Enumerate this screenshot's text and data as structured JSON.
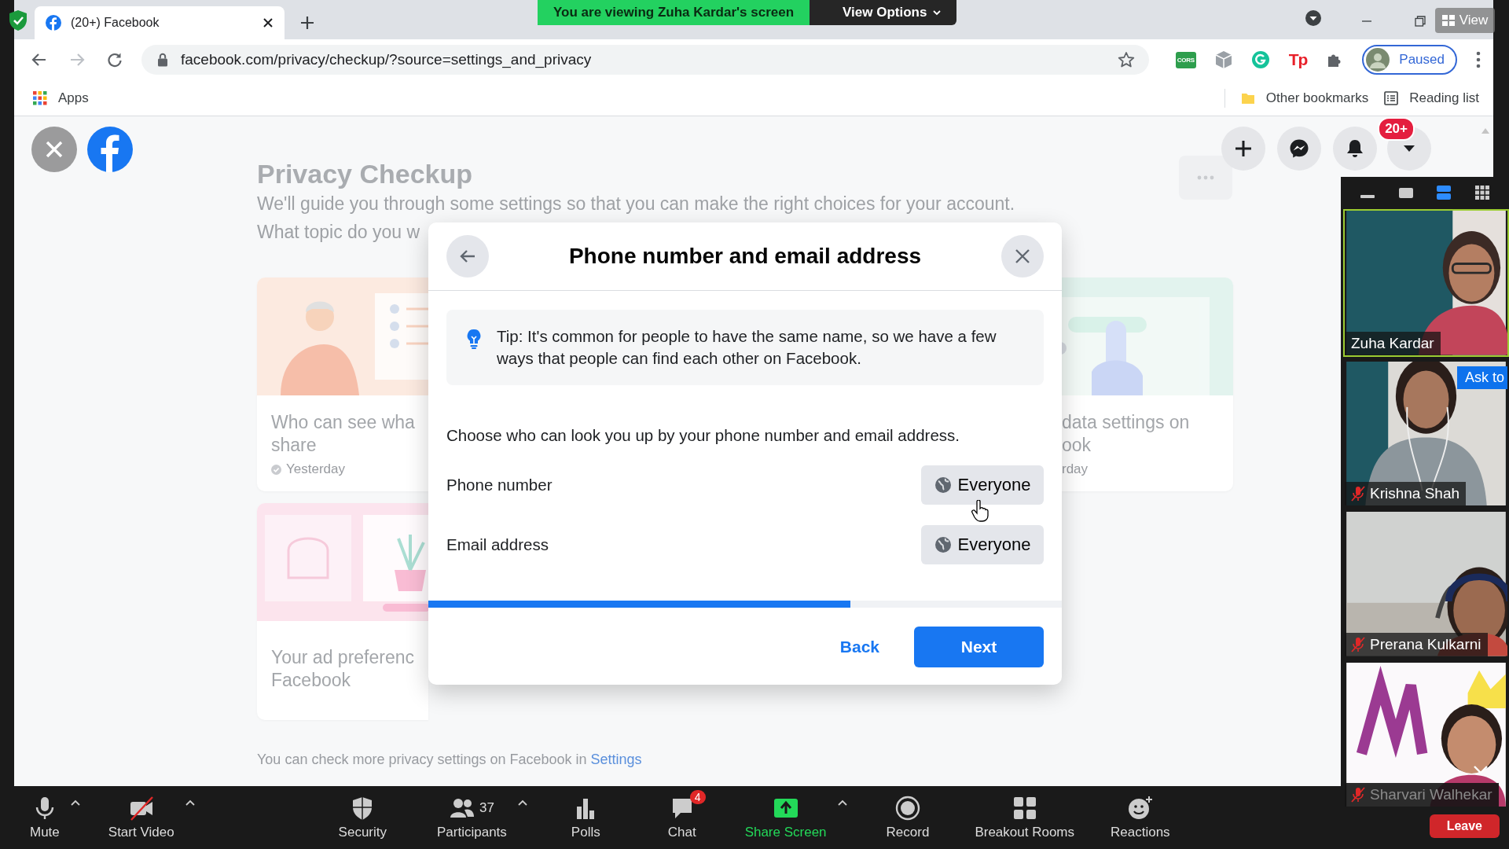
{
  "zoom_banner": {
    "message": "You are viewing Zuha Kardar's screen",
    "options_button": "View Options"
  },
  "view_button": "View",
  "browser": {
    "tab": {
      "title": "(20+) Facebook"
    },
    "url": "facebook.com/privacy/checkup/?source=settings_and_privacy",
    "extensions": [
      {
        "kind": "cors",
        "label": "CORS"
      },
      {
        "kind": "cube"
      },
      {
        "kind": "grammar"
      },
      {
        "kind": "tp",
        "label": "Tp"
      },
      {
        "kind": "puzzle"
      }
    ],
    "profile": "Paused",
    "bookmarks": {
      "apps": "Apps",
      "other": "Other bookmarks",
      "reading_list": "Reading list"
    }
  },
  "page": {
    "notification_badge": "20+",
    "title": "Privacy Checkup",
    "subtitle": [
      "We'll guide you through some settings so that you can make the right choices for your account.",
      "What topic do you w"
    ],
    "cards": [
      {
        "kind": "audience",
        "color": "#fbe3d6",
        "title_lines": [
          "Who can see wha",
          "share"
        ],
        "meta": "Yesterday",
        "done": true
      },
      {
        "kind": "data",
        "color": "#d9efe9",
        "title_lines": [
          "data settings on",
          "ook"
        ],
        "meta": "rday",
        "done": false
      },
      {
        "kind": "ads",
        "color": "#fbdbe8",
        "title_lines": [
          "Your ad preferenc",
          "Facebook"
        ]
      }
    ],
    "footer": {
      "text": "You can check more privacy settings on Facebook in ",
      "link": "Settings"
    }
  },
  "modal": {
    "title": "Phone number and email address",
    "tip": "Tip: It's common for people to have the same name, so we have a few ways that people can find each other on Facebook.",
    "prompt": "Choose who can look you up by your phone number and email address.",
    "settings": [
      {
        "label": "Phone number",
        "value": "Everyone"
      },
      {
        "label": "Email address",
        "value": "Everyone"
      }
    ],
    "progress": {
      "level": 0.666
    },
    "back": "Back",
    "next": "Next"
  },
  "video_panel": {
    "views": [
      {
        "kind": "minimize",
        "selected": false
      },
      {
        "kind": "single",
        "selected": false
      },
      {
        "kind": "strip",
        "selected": true
      },
      {
        "kind": "gallery",
        "selected": false
      }
    ],
    "tiles": [
      {
        "kind": "office",
        "name": "Zuha Kardar",
        "muted": false,
        "speaking": true,
        "faded": false
      },
      {
        "kind": "office2",
        "name": "Krishna Shah",
        "muted": true,
        "speaking": false,
        "faded": false,
        "action": "Ask to"
      },
      {
        "kind": "room",
        "name": "Prerana Kulkarni",
        "muted": true,
        "speaking": false,
        "faded": false
      },
      {
        "kind": "banner",
        "name": "Sharvari Walhekar",
        "muted": true,
        "speaking": false,
        "faded": true
      }
    ]
  },
  "toolbar": {
    "items": [
      {
        "kind": "mic",
        "label": "Mute",
        "caret": true,
        "highlight": false
      },
      {
        "kind": "video-off",
        "label": "Start Video",
        "caret": true,
        "highlight": false
      },
      {
        "kind": "shield",
        "label": "Security",
        "caret": false,
        "highlight": false
      },
      {
        "kind": "people",
        "label": "Participants",
        "count": "37",
        "caret": true,
        "highlight": false
      },
      {
        "kind": "polls",
        "label": "Polls",
        "caret": false,
        "highlight": false
      },
      {
        "kind": "chat",
        "label": "Chat",
        "badge": "4",
        "caret": false,
        "highlight": false
      },
      {
        "kind": "share",
        "label": "Share Screen",
        "caret": true,
        "highlight": true
      },
      {
        "kind": "record",
        "label": "Record",
        "caret": false,
        "highlight": false
      },
      {
        "kind": "rooms",
        "label": "Breakout Rooms",
        "caret": false,
        "highlight": false
      },
      {
        "kind": "reactions",
        "label": "Reactions",
        "caret": false,
        "highlight": false
      }
    ],
    "leave": "Leave"
  }
}
